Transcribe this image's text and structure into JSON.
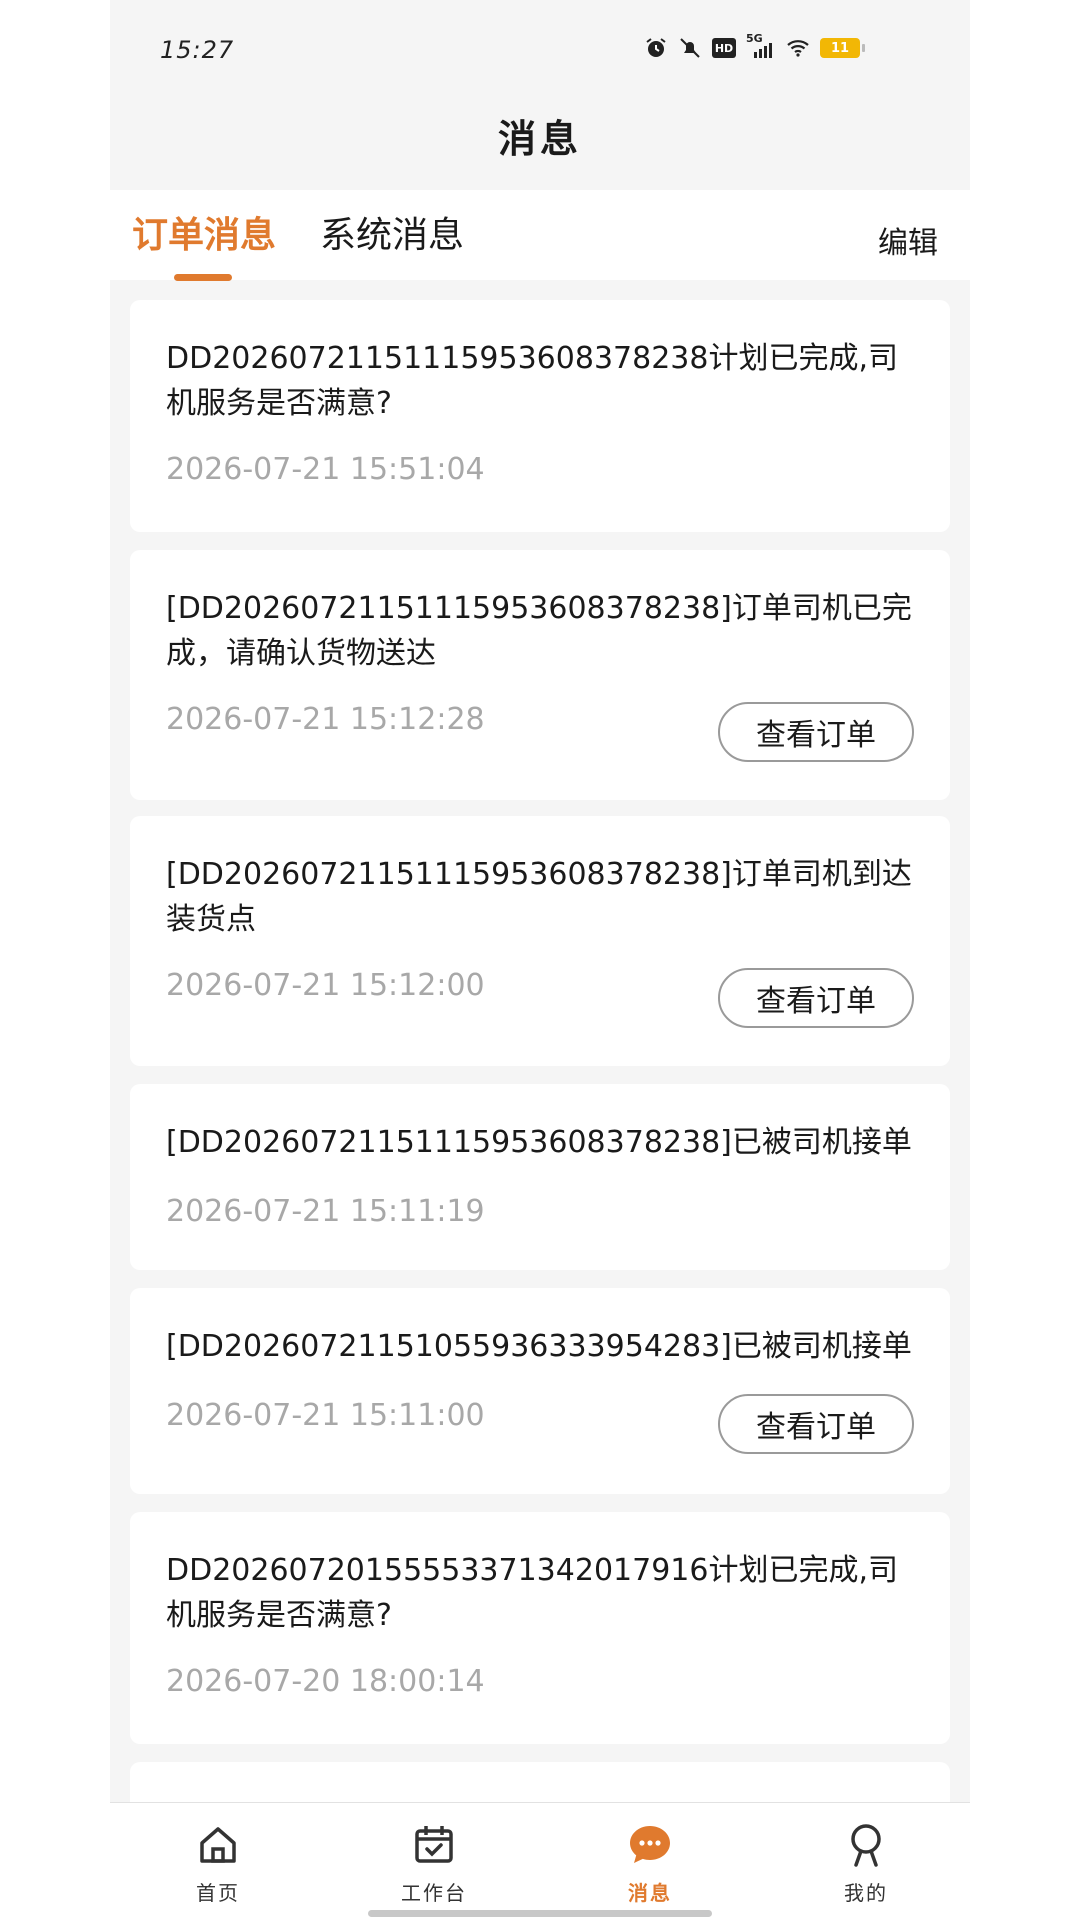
{
  "status_bar": {
    "time": "15:27",
    "network": "5G",
    "hd": "HD",
    "battery": "11"
  },
  "header": {
    "title": "消息"
  },
  "tabs": {
    "items": [
      {
        "label": "订单消息",
        "active": true
      },
      {
        "label": "系统消息",
        "active": false
      }
    ],
    "edit_label": "编辑"
  },
  "messages": [
    {
      "text": "DD20260721151115953608378238计划已完成,司机服务是否满意?",
      "time": "2026-07-21 15:51:04",
      "button": ""
    },
    {
      "text": "[DD20260721151115953608378238]订单司机已完成，请确认货物送达",
      "time": "2026-07-21 15:12:28",
      "button": "查看订单"
    },
    {
      "text": "[DD20260721151115953608378238]订单司机到达装货点",
      "time": "2026-07-21 15:12:00",
      "button": "查看订单"
    },
    {
      "text": "[DD20260721151115953608378238]已被司机接单",
      "time": "2026-07-21 15:11:19",
      "button": ""
    },
    {
      "text": "[DD20260721151055936333954283]已被司机接单",
      "time": "2026-07-21 15:11:00",
      "button": "查看订单"
    },
    {
      "text": "DD20260720155553371342017916计划已完成,司机服务是否满意?",
      "time": "2026-07-20 18:00:14",
      "button": ""
    }
  ],
  "tabbar": {
    "items": [
      {
        "label": "首页",
        "icon": "home-icon",
        "active": false
      },
      {
        "label": "工作台",
        "icon": "calendar-check-icon",
        "active": false
      },
      {
        "label": "消息",
        "icon": "chat-bubble-icon",
        "active": true
      },
      {
        "label": "我的",
        "icon": "user-icon",
        "active": false
      }
    ]
  },
  "colors": {
    "accent": "#e07a2e",
    "background": "#f5f5f5",
    "card": "#ffffff",
    "timestamp": "#a8a8a8"
  }
}
